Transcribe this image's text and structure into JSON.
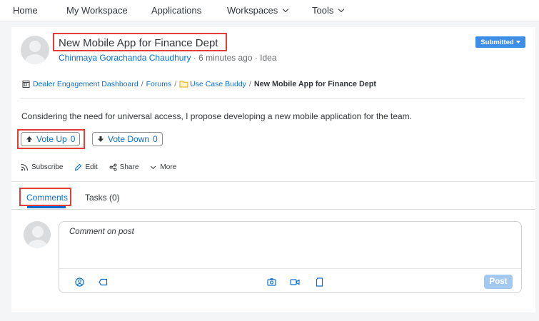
{
  "topnav": {
    "home": "Home",
    "my_workspace": "My Workspace",
    "applications": "Applications",
    "workspaces": "Workspaces",
    "tools": "Tools"
  },
  "post": {
    "title": "New Mobile App for Finance Dept",
    "author": "Chinmaya Gorachanda Chaudhury",
    "meta": " · 6 minutes ago · Idea",
    "status": "Submitted",
    "breadcrumb": {
      "dashboard": "Dealer Engagement Dashboard",
      "forums": "Forums",
      "folder": "Use Case Buddy",
      "current": "New Mobile App for Finance Dept",
      "separator": "/"
    },
    "body": "Considering the need for universal access, I propose developing a new mobile application for the team.",
    "vote_up": {
      "label": "Vote Up",
      "count": "0"
    },
    "vote_down": {
      "label": "Vote Down",
      "count": "0"
    },
    "actions": {
      "subscribe": "Subscribe",
      "edit": "Edit",
      "share": "Share",
      "more": "More"
    }
  },
  "tabs": {
    "comments": "Comments",
    "tasks": "Tasks (0)"
  },
  "comment": {
    "placeholder": "Comment on post",
    "post_label": "Post"
  },
  "colors": {
    "link": "#0a6ed1",
    "status_bg": "#3d8ee6",
    "highlight": "#e43b3b",
    "post_btn_disabled": "#a4c9f0"
  }
}
